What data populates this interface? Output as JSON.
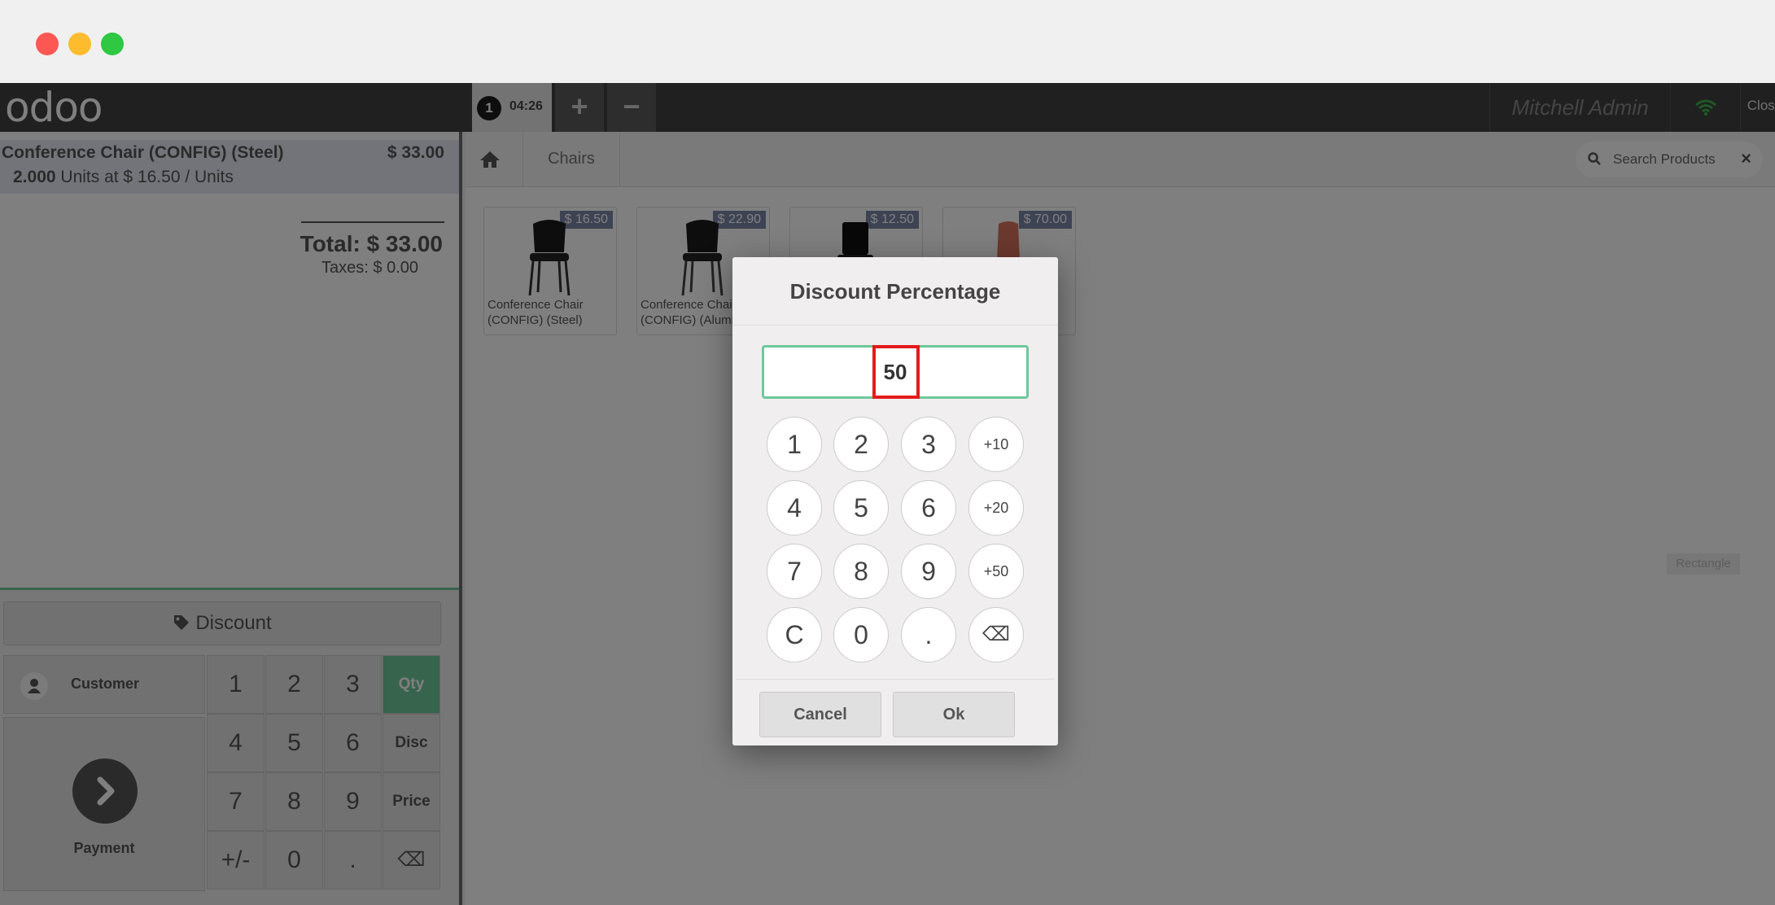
{
  "app": {
    "logo": "odoo",
    "order_tab": {
      "number": "1",
      "time": "04:26"
    },
    "add_tab_label": "+",
    "remove_tab_label": "−",
    "user_name": "Mitchell Admin",
    "close_label": "Close"
  },
  "order": {
    "line": {
      "product": "Conference Chair (CONFIG) (Steel)",
      "price": "$ 33.00",
      "qty": "2.000",
      "unit_info": "Units at $ 16.50 / Units"
    },
    "total": "Total: $ 33.00",
    "taxes": "Taxes: $ 0.00"
  },
  "controls": {
    "discount_label": "Discount",
    "customer_label": "Customer",
    "payment_label": "Payment",
    "numpad": {
      "keys": [
        "1",
        "2",
        "3",
        "Qty",
        "4",
        "5",
        "6",
        "Disc",
        "7",
        "8",
        "9",
        "Price",
        "+/-",
        "0",
        ".",
        "⌫"
      ],
      "active_mode": "Qty"
    }
  },
  "products": {
    "breadcrumb": "Chairs",
    "search_placeholder": "Search Products",
    "items": [
      {
        "name": "Conference Chair (CONFIG) (Steel)",
        "price": "$ 16.50"
      },
      {
        "name": "Conference Chair (CONFIG) (Alumin",
        "price": "$ 22.90"
      },
      {
        "name": "",
        "price": "$ 12.50"
      },
      {
        "name": "",
        "price": "$ 70.00"
      }
    ],
    "rectangle_label": "Rectangle"
  },
  "modal": {
    "title": "Discount Percentage",
    "value": "50",
    "keys": [
      "1",
      "2",
      "3",
      "+10",
      "4",
      "5",
      "6",
      "+20",
      "7",
      "8",
      "9",
      "+50",
      "C",
      "0",
      ".",
      "⌫"
    ],
    "cancel_label": "Cancel",
    "ok_label": "Ok"
  },
  "colors": {
    "accent": "#6ec89b",
    "highlight": "#e31b1b",
    "topbar": "#414141",
    "price_tag": "#7c87a9"
  }
}
